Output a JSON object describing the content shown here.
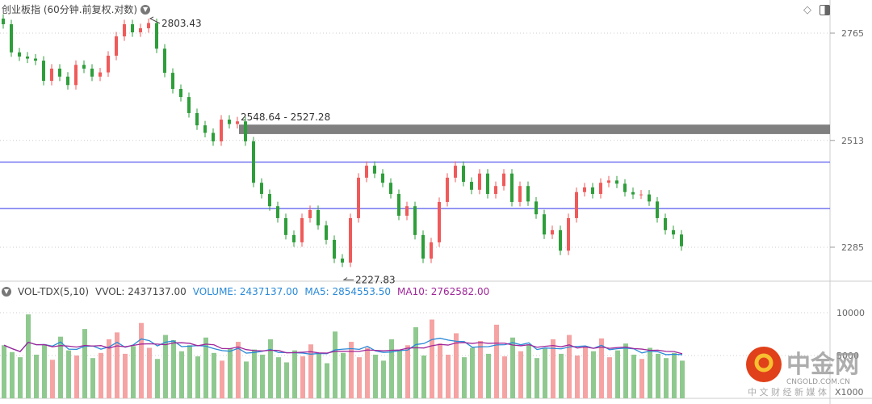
{
  "header": {
    "title": "创业板指 (60分钟.前复权.对数)"
  },
  "volume_header": {
    "indicator": "VOL-TDX(5,10)",
    "vvol": "VVOL: 2437137.00",
    "volume": "VOLUME: 2437137.00",
    "ma5": "MA5: 2854553.50",
    "ma10": "MA10: 2762582.00"
  },
  "annotations": {
    "high": "2803.43",
    "low": "2227.83",
    "gap": "2548.64 - 2527.28"
  },
  "watermark": {
    "brand": "中金网",
    "domain": "CNGOLD.COM.CN",
    "tagline": "中 文 财 经 新 媒 体"
  },
  "colors": {
    "up": "#f05a5a",
    "down": "#2e9e3a",
    "up_vol": "#f5a3a3",
    "down_vol": "#8fc98f",
    "hline": "#5a5aee",
    "gap": "#808080",
    "ma5": "#2a8ad8",
    "ma10": "#a0269a"
  },
  "chart_data": [
    {
      "type": "candlestick",
      "scale": "log",
      "price_ticks": [
        2765,
        2513,
        2285
      ],
      "horizontal_lines": [
        2465,
        2365
      ],
      "gap_zone": [
        2548.64,
        2527.28
      ],
      "closes": [
        2787,
        2718,
        2708,
        2703,
        2698,
        2650,
        2679,
        2660,
        2640,
        2688,
        2679,
        2660,
        2670,
        2710,
        2757,
        2787,
        2767,
        2777,
        2790,
        2727,
        2669,
        2631,
        2612,
        2575,
        2547,
        2530,
        2511,
        2560,
        2550,
        2556,
        2511,
        2420,
        2396,
        2370,
        2345,
        2310,
        2295,
        2345,
        2362,
        2330,
        2300,
        2262,
        2254,
        2345,
        2431,
        2457,
        2440,
        2420,
        2396,
        2350,
        2370,
        2310,
        2262,
        2295,
        2379,
        2431,
        2457,
        2422,
        2405,
        2440,
        2396,
        2413,
        2440,
        2379,
        2413,
        2380,
        2353,
        2311,
        2320,
        2278,
        2345,
        2400,
        2410,
        2396,
        2420,
        2425,
        2418,
        2400,
        2395,
        2395,
        2380,
        2345,
        2320,
        2311,
        2287
      ]
    },
    {
      "type": "bar",
      "name": "VOL-TDX",
      "unit": "X1000",
      "ticks": [
        10000,
        5000
      ],
      "values": [
        6200,
        5400,
        4800,
        9800,
        5100,
        6300,
        4500,
        7200,
        5600,
        5000,
        8100,
        4700,
        5300,
        6900,
        7700,
        5200,
        6100,
        8800,
        5900,
        4600,
        7400,
        6800,
        5500,
        6200,
        4900,
        7100,
        5300,
        4400,
        5800,
        6600,
        4300,
        5700,
        5100,
        6900,
        4800,
        4200,
        5600,
        4900,
        6300,
        5200,
        4100,
        7800,
        5300,
        6600,
        4800,
        5900,
        5100,
        4400,
        6900,
        5600,
        6200,
        8300,
        5000,
        9200,
        6400,
        5100,
        7600,
        4800,
        5900,
        6700,
        5200,
        8600,
        4900,
        7100,
        5500,
        6300,
        4700,
        5800,
        6900,
        5200,
        7400,
        5000,
        6100,
        5500,
        7000,
        4800,
        5600,
        6400,
        5100,
        4600,
        5900,
        5200,
        4700,
        5300,
        4400
      ]
    }
  ]
}
